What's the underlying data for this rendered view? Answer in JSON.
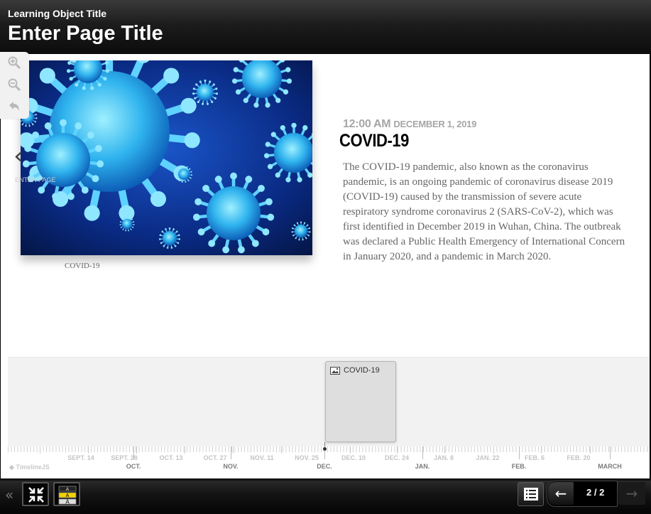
{
  "header": {
    "learning_object_title": "Learning Object Title",
    "page_title": "Enter Page Title"
  },
  "zoom_toolbar": {
    "icons": [
      "zoom-in-icon",
      "zoom-out-icon",
      "back-icon"
    ]
  },
  "slide": {
    "prev_arrow": "‹",
    "prev_label": "ENTER PAGE",
    "media_caption": "COVID-19",
    "date_time": "12:00 AM",
    "date_day": "DECEMBER 1, 2019",
    "headline": "COVID-19",
    "body": "The COVID-19 pandemic, also known as the coronavirus pandemic, is an ongoing pandemic of coronavirus disease 2019 (COVID-19) caused by the transmission of severe acute respiratory syndrome coronavirus 2 (SARS-CoV-2), which was first identified in December 2019 in Wuhan, China. The outbreak was declared a Public Health Emergency of International Concern in January 2020, and a pandemic in March 2020."
  },
  "timeline": {
    "marker_label": "COVID-19",
    "brand": "TimelineJS",
    "minor_labels": [
      "SEPT. 14",
      "SEPT. 28",
      "OCT. 13",
      "OCT. 27",
      "NOV. 11",
      "NOV. 25",
      "DEC. 10",
      "DEC. 24",
      "JAN. 8",
      "JAN. 22",
      "FEB. 6",
      "FEB. 20"
    ],
    "major_labels": [
      "OCT.",
      "NOV.",
      "DEC.",
      "JAN.",
      "FEB.",
      "MARCH"
    ]
  },
  "bottom_bar": {
    "collapse": "«",
    "page_counter": "2 / 2",
    "prev_arrow": "←",
    "next_arrow": "→"
  },
  "colors": {
    "header_bg": "#1c1c1c",
    "timenav_bg": "#f2f2f2",
    "marker_bg": "#dedede",
    "text_gray": "#666666"
  }
}
